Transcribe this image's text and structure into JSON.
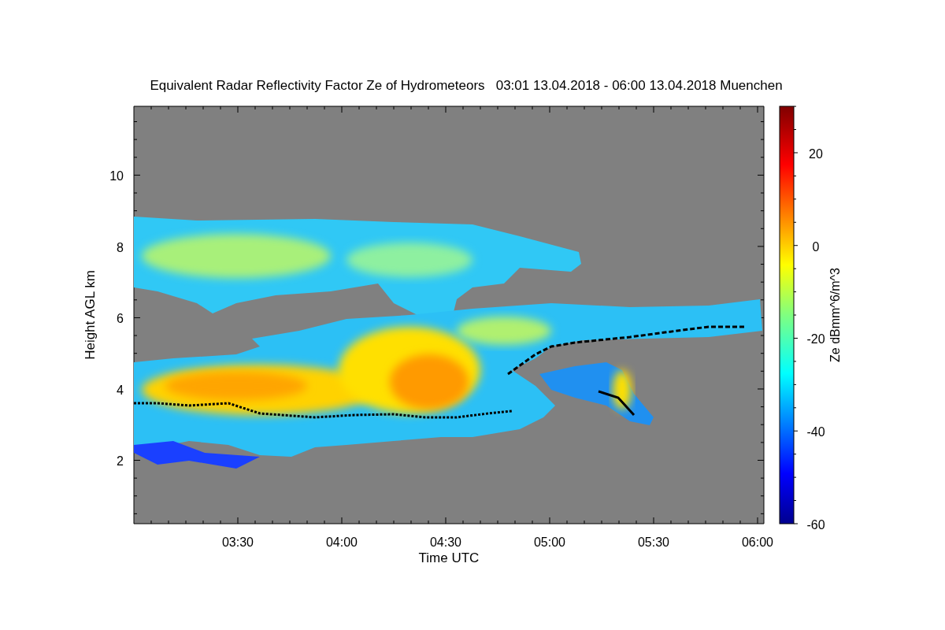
{
  "title": "Equivalent Radar Reflectivity Factor Ze of Hydrometeors   03:01 13.04.2018 - 06:00 13.04.2018 Muenchen",
  "plot": {
    "ylabel": "Height AGL km",
    "xlabel": "Time UTC",
    "yticks": [
      "10",
      "8",
      "6",
      "4",
      "2"
    ],
    "xticks": [
      "03:30",
      "04:00",
      "04:30",
      "05:00",
      "05:30",
      "06:00"
    ]
  },
  "colorbar": {
    "label": "Ze dBmm^6/m^3",
    "ticks": [
      "20",
      "0",
      "-20",
      "-40",
      "-60"
    ]
  }
}
